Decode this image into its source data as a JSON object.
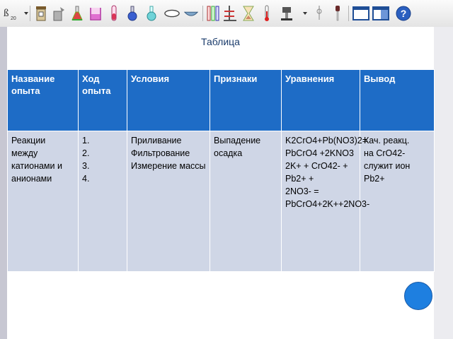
{
  "toolbar": {
    "icons": [
      "periodic-icon",
      "jar-icon",
      "dropper-bottle-icon",
      "flask-red-icon",
      "beaker-icon",
      "test-tube-icon",
      "round-flask-icon",
      "flask-blue-icon",
      "dish-icon",
      "crucible-icon",
      "tube-rack-icon",
      "stand-icon",
      "hourglass-icon",
      "thermometer-icon",
      "burner-icon",
      "pipette-icon",
      "dropper-icon",
      "window-icon",
      "split-view-icon",
      "help-icon"
    ],
    "corner_label": "20"
  },
  "slide": {
    "title": "Таблица",
    "table": {
      "headers": [
        "Название опыта",
        "Ход опыта",
        "Условия",
        "Признаки",
        "Уравнения",
        "Вывод"
      ],
      "row": {
        "name": "Реакции между катионами и анионами",
        "steps": [
          "1.",
          "2.",
          "3.",
          "4."
        ],
        "conditions": [
          "Приливание",
          "Фильтрование",
          "Измерение массы"
        ],
        "signs": "Выпадение осадка",
        "equations": [
          "K2CrO4+Pb(NO3)2=",
          "PbCrO4 +2KNO3",
          "2K+ + CrO42- + Pb2+ +",
          "2NO3- =",
          "PbCrO4+2K++2NO3-"
        ],
        "conclusion": [
          "Кач. реакц.",
          "на CrO42-",
          "служит ион",
          "Pb2+"
        ]
      }
    }
  },
  "colors": {
    "header_bg": "#1e6cc6",
    "cell_bg": "#cfd6e6",
    "title": "#1a3b6b",
    "circle": "#1e7fe0"
  }
}
